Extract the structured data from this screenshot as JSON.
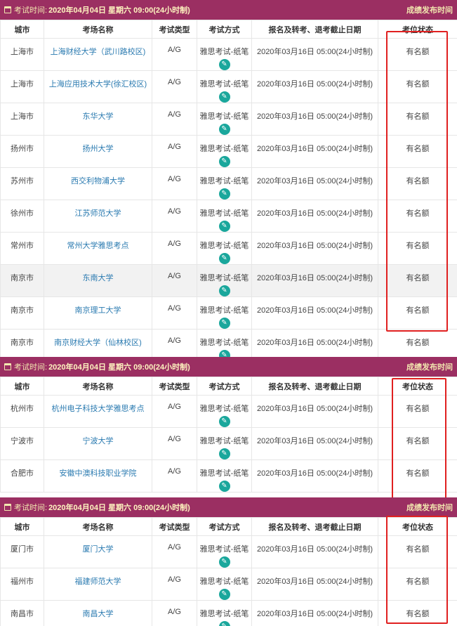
{
  "colors": {
    "header_bg": "#9b2f62",
    "link": "#2a7ab0",
    "icon": "#1aa79c",
    "highlight_box": "#e02020"
  },
  "columns": [
    "城市",
    "考场名称",
    "考试类型",
    "考试方式",
    "报名及转考、退考截止日期",
    "考位状态"
  ],
  "sections": [
    {
      "exam_label": "考试时间:",
      "exam_date": "2020年04月04日 星期六 09:00(24小时制)",
      "result_link": "成绩发布时间",
      "rows": [
        {
          "city": "上海市",
          "venue": "上海财经大学（武川路校区)",
          "type": "A/G",
          "method": "雅思考试-纸笔",
          "deadline": "2020年03月16日 05:00(24小时制)",
          "status": "有名额"
        },
        {
          "city": "上海市",
          "venue": "上海应用技术大学(徐汇校区)",
          "type": "A/G",
          "method": "雅思考试-纸笔",
          "deadline": "2020年03月16日 05:00(24小时制)",
          "status": "有名额"
        },
        {
          "city": "上海市",
          "venue": "东华大学",
          "type": "A/G",
          "method": "雅思考试-纸笔",
          "deadline": "2020年03月16日 05:00(24小时制)",
          "status": "有名额"
        },
        {
          "city": "扬州市",
          "venue": "扬州大学",
          "type": "A/G",
          "method": "雅思考试-纸笔",
          "deadline": "2020年03月16日 05:00(24小时制)",
          "status": "有名额"
        },
        {
          "city": "苏州市",
          "venue": "西交利物浦大学",
          "type": "A/G",
          "method": "雅思考试-纸笔",
          "deadline": "2020年03月16日 05:00(24小时制)",
          "status": "有名额"
        },
        {
          "city": "徐州市",
          "venue": "江苏师范大学",
          "type": "A/G",
          "method": "雅思考试-纸笔",
          "deadline": "2020年03月16日 05:00(24小时制)",
          "status": "有名额"
        },
        {
          "city": "常州市",
          "venue": "常州大学雅思考点",
          "type": "A/G",
          "method": "雅思考试-纸笔",
          "deadline": "2020年03月16日 05:00(24小时制)",
          "status": "有名额"
        },
        {
          "city": "南京市",
          "venue": "东南大学",
          "type": "A/G",
          "method": "雅思考试-纸笔",
          "deadline": "2020年03月16日 05:00(24小时制)",
          "status": "有名额",
          "highlight": true
        },
        {
          "city": "南京市",
          "venue": "南京理工大学",
          "type": "A/G",
          "method": "雅思考试-纸笔",
          "deadline": "2020年03月16日 05:00(24小时制)",
          "status": "有名额"
        },
        {
          "city": "南京市",
          "venue": "南京财经大学（仙林校区)",
          "type": "A/G",
          "method": "雅思考试-纸笔",
          "deadline": "2020年03月16日 05:00(24小时制)",
          "status": "有名额"
        }
      ]
    },
    {
      "exam_label": "考试时间:",
      "exam_date": "2020年04月04日 星期六 09:00(24小时制)",
      "result_link": "成绩发布时间",
      "rows": [
        {
          "city": "杭州市",
          "venue": "杭州电子科技大学雅思考点",
          "type": "A/G",
          "method": "雅思考试-纸笔",
          "deadline": "2020年03月16日 05:00(24小时制)",
          "status": "有名额"
        },
        {
          "city": "宁波市",
          "venue": "宁波大学",
          "type": "A/G",
          "method": "雅思考试-纸笔",
          "deadline": "2020年03月16日 05:00(24小时制)",
          "status": "有名额"
        },
        {
          "city": "合肥市",
          "venue": "安徽中澳科技职业学院",
          "type": "A/G",
          "method": "雅思考试-纸笔",
          "deadline": "2020年03月16日 05:00(24小时制)",
          "status": "有名额"
        }
      ]
    },
    {
      "exam_label": "考试时间:",
      "exam_date": "2020年04月04日 星期六 09:00(24小时制)",
      "result_link": "成绩发布时间",
      "rows": [
        {
          "city": "厦门市",
          "venue": "厦门大学",
          "type": "A/G",
          "method": "雅思考试-纸笔",
          "deadline": "2020年03月16日 05:00(24小时制)",
          "status": "有名额"
        },
        {
          "city": "福州市",
          "venue": "福建师范大学",
          "type": "A/G",
          "method": "雅思考试-纸笔",
          "deadline": "2020年03月16日 05:00(24小时制)",
          "status": "有名额"
        },
        {
          "city": "南昌市",
          "venue": "南昌大学",
          "type": "A/G",
          "method": "雅思考试-纸笔",
          "deadline": "2020年03月16日 05:00(24小时制)",
          "status": "有名额"
        }
      ]
    }
  ]
}
